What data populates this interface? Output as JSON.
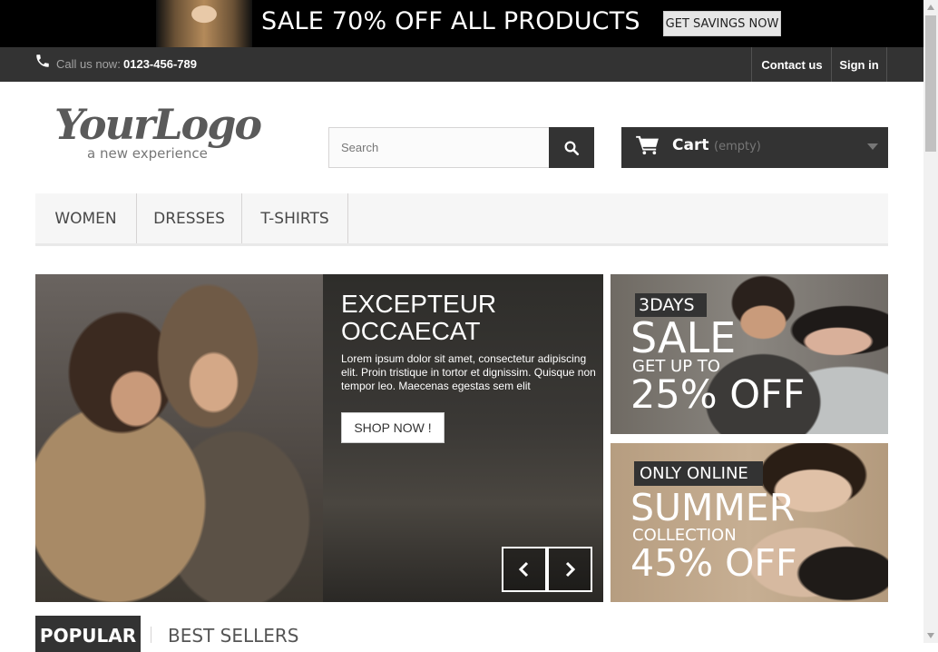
{
  "promo": {
    "text": "SALE 70% OFF ALL PRODUCTS",
    "button": "GET SAVINGS NOW"
  },
  "topbar": {
    "call_label": "Call us now:",
    "phone": "0123-456-789",
    "contact": "Contact us",
    "signin": "Sign in"
  },
  "logo": {
    "main": "YourLogo",
    "sub": "a new experience"
  },
  "search": {
    "placeholder": "Search"
  },
  "cart": {
    "label": "Cart",
    "status": "(empty)"
  },
  "menu": {
    "items": [
      "WOMEN",
      "DRESSES",
      "T-SHIRTS"
    ]
  },
  "slider": {
    "title": "EXCEPTEUR OCCAECAT",
    "text": "Lorem ipsum dolor sit amet, consectetur adipiscing elit. Proin tristique in tortor et dignissim. Quisque non tempor leo. Maecenas egestas sem elit",
    "button": "SHOP NOW !"
  },
  "banners": [
    {
      "tag": "3DAYS",
      "line1": "SALE",
      "line2": "GET UP TO",
      "line3": "25% OFF"
    },
    {
      "tag": "ONLY ONLINE",
      "line1": "SUMMER",
      "line2": "COLLECTION",
      "line3": "45% OFF"
    }
  ],
  "tabs": {
    "popular": "POPULAR",
    "best_sellers": "BEST SELLERS"
  },
  "colors": {
    "dark": "#333333",
    "menu_bg": "#f6f6f6",
    "black_bar": "#000000"
  },
  "icons": [
    "phone-icon",
    "search-icon",
    "cart-icon",
    "chevron-down-icon",
    "chevron-left-icon",
    "chevron-right-icon"
  ]
}
